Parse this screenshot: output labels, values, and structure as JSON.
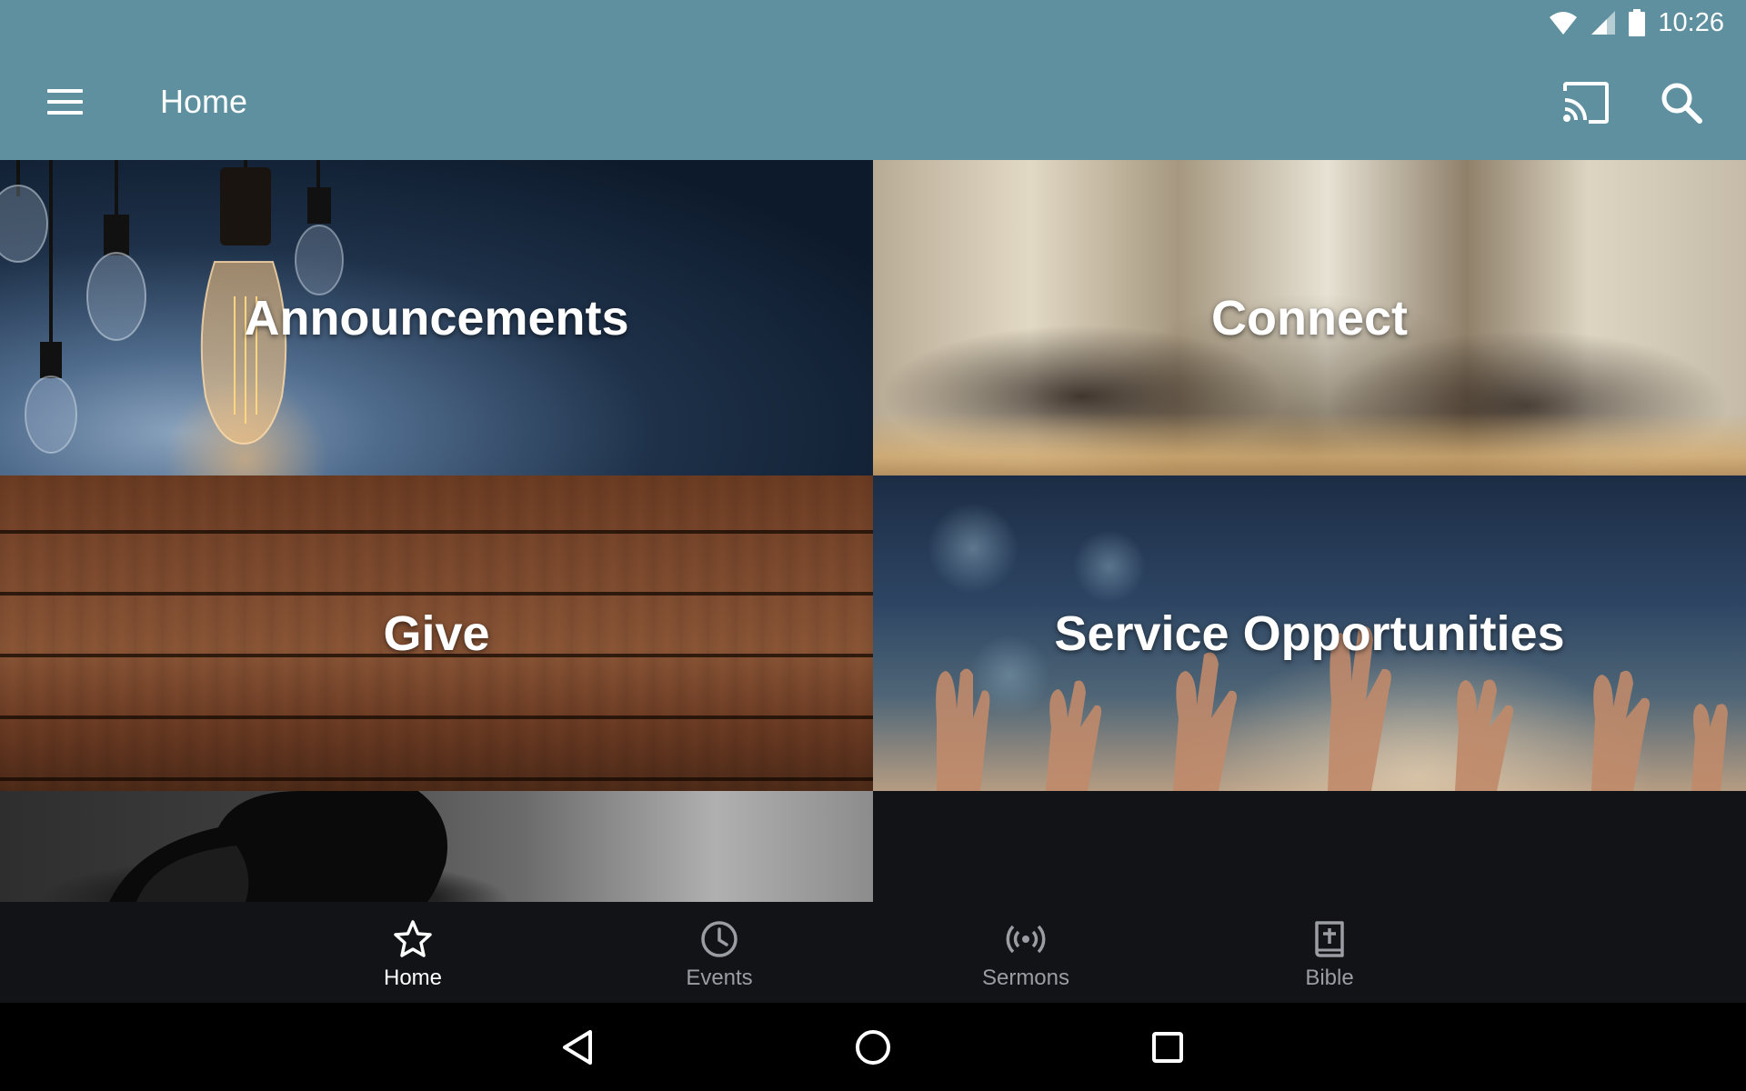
{
  "status_bar": {
    "time": "10:26",
    "icons": [
      "wifi-icon",
      "signal-icon",
      "battery-icon"
    ]
  },
  "toolbar": {
    "title": "Home",
    "icons": [
      "menu-icon",
      "cast-icon",
      "search-icon"
    ],
    "background_color": "#5e909f"
  },
  "tiles": [
    {
      "label": "Announcements"
    },
    {
      "label": "Connect"
    },
    {
      "label": "Give"
    },
    {
      "label": "Service Opportunities"
    }
  ],
  "bottom_nav": {
    "items": [
      {
        "label": "Home",
        "icon": "star-icon",
        "active": true
      },
      {
        "label": "Events",
        "icon": "clock-icon",
        "active": false
      },
      {
        "label": "Sermons",
        "icon": "broadcast-icon",
        "active": false
      },
      {
        "label": "Bible",
        "icon": "bible-icon",
        "active": false
      }
    ]
  },
  "system_nav": {
    "icons": [
      "back-icon",
      "home-circle-icon",
      "recents-icon"
    ]
  }
}
